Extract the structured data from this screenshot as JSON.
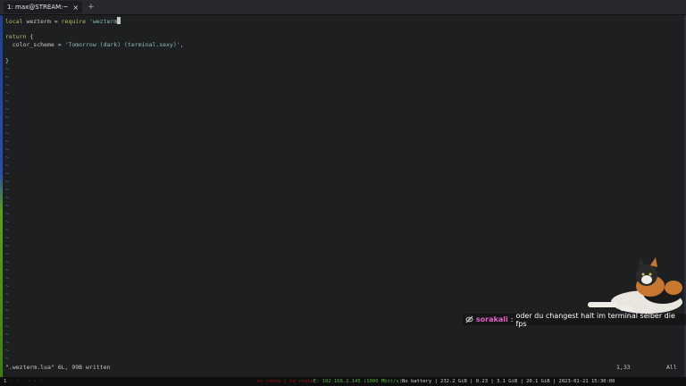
{
  "tabs": [
    {
      "label": "1: max@STREAM:~",
      "close": "×"
    }
  ],
  "new_tab": "+",
  "buffer": {
    "lines": [
      {
        "segments": [
          {
            "t": "local ",
            "c": "kw"
          },
          {
            "t": "wezterm = ",
            "c": "id"
          },
          {
            "t": "require ",
            "c": "kw"
          },
          {
            "t": "'wezterm",
            "c": "str"
          },
          {
            "t": "'",
            "c": "cursor"
          }
        ]
      },
      {
        "segments": []
      },
      {
        "segments": [
          {
            "t": "return",
            "c": "kw"
          },
          {
            "t": " {",
            "c": "id"
          }
        ]
      },
      {
        "segments": [
          {
            "t": "  color_scheme = ",
            "c": "id"
          },
          {
            "t": "'Tomorrow (dark) (terminal.sexy)'",
            "c": "str"
          },
          {
            "t": ",",
            "c": "id"
          }
        ]
      },
      {
        "segments": []
      },
      {
        "segments": [
          {
            "t": "}",
            "c": "id"
          }
        ]
      }
    ],
    "tilde": "~"
  },
  "command_line": "\".wezterm.lua\" 6L, 99B written",
  "ruler": {
    "position": "1,33",
    "scroll": "All"
  },
  "chat": {
    "username": "sorakali",
    "separator": ":",
    "message": "oder du changest halt im terminal selber die fps"
  },
  "statusbar": {
    "workspace": "1",
    "dots": "· · · · · ·",
    "net_down": "no route | no route",
    "ip": "E: 192.168.2.145 (1000 Mbit/s)",
    "info": "No battery | 232.2 GiB | 0.23 | 3.1 GiB | 20.1 GiB | 2023-01-21 15:30:00"
  }
}
